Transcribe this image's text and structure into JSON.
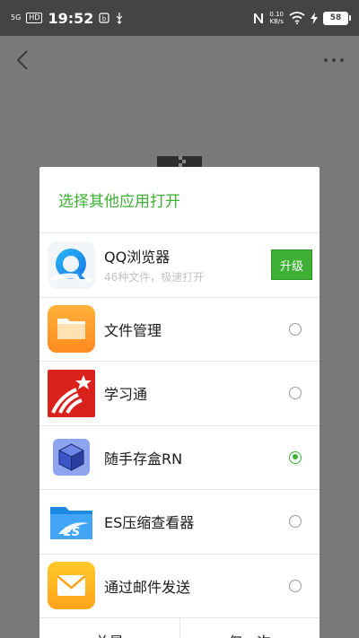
{
  "status_bar": {
    "network": "5G",
    "hd": "HD",
    "time": "19:52",
    "speed_value": "0.10",
    "speed_unit": "KB/s",
    "battery": "58"
  },
  "dialog": {
    "title": "选择其他应用打开",
    "apps": [
      {
        "name": "QQ浏览器",
        "subtitle": "46种文件，极速打开",
        "action": "升级",
        "icon": "qq-browser-icon"
      },
      {
        "name": "文件管理",
        "selected": false,
        "icon": "file-manager-icon"
      },
      {
        "name": "学习通",
        "selected": false,
        "icon": "xuexitong-icon"
      },
      {
        "name": "随手存盒RN",
        "selected": true,
        "icon": "cube-box-icon"
      },
      {
        "name": "ES压缩查看器",
        "selected": false,
        "icon": "es-folder-icon"
      },
      {
        "name": "通过邮件发送",
        "selected": false,
        "icon": "mail-icon"
      }
    ],
    "footer": {
      "left": "总是",
      "right": "仅一次"
    }
  },
  "colors": {
    "accent": "#3db035",
    "overlay": "#7a7a7a"
  }
}
